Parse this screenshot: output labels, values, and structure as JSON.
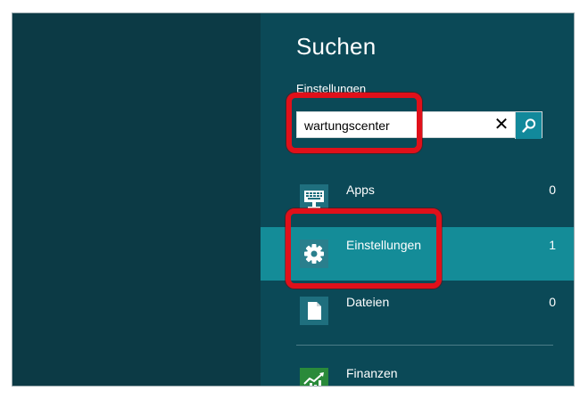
{
  "charm": {
    "title": "Suchen",
    "scope_label": "Einstellungen",
    "search": {
      "value": "wartungscenter",
      "clear_symbol": "✕"
    }
  },
  "results": [
    {
      "label": "Apps",
      "count": "0",
      "icon": "keyboard-monitor-icon",
      "selected": false
    },
    {
      "label": "Einstellungen",
      "count": "1",
      "icon": "gear-icon",
      "selected": true
    },
    {
      "label": "Dateien",
      "count": "0",
      "icon": "document-icon",
      "selected": false
    }
  ],
  "apps": [
    {
      "label": "Finanzen",
      "icon": "finance-chart-icon"
    }
  ],
  "colors": {
    "charm_background": "#0b4957",
    "selected_row": "#148c98",
    "search_button": "#12899b",
    "annotation_red": "#e0101a"
  }
}
